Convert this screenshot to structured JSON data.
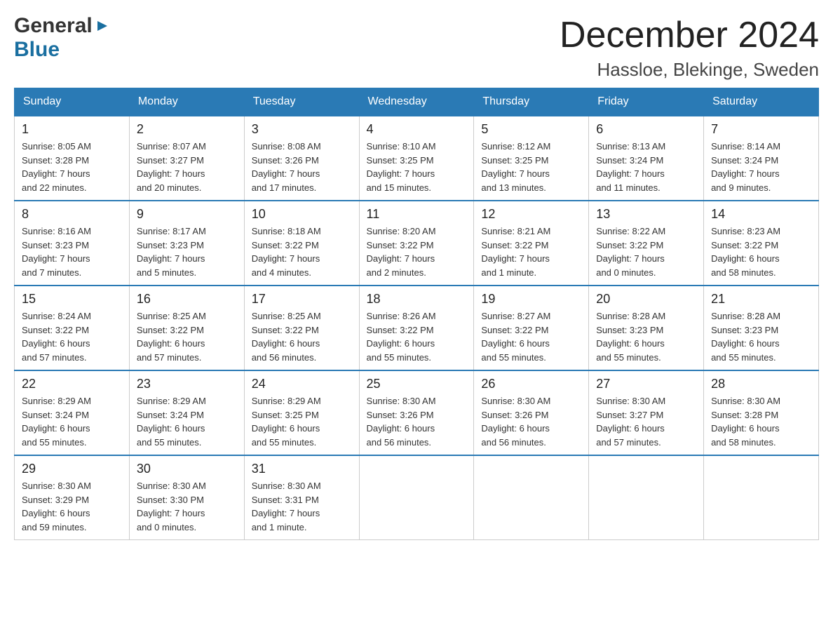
{
  "logo": {
    "general": "General",
    "blue": "Blue",
    "triangle": "▶"
  },
  "title": "December 2024",
  "location": "Hassloe, Blekinge, Sweden",
  "headers": [
    "Sunday",
    "Monday",
    "Tuesday",
    "Wednesday",
    "Thursday",
    "Friday",
    "Saturday"
  ],
  "weeks": [
    [
      {
        "day": "1",
        "sunrise": "Sunrise: 8:05 AM",
        "sunset": "Sunset: 3:28 PM",
        "daylight": "Daylight: 7 hours",
        "daylight2": "and 22 minutes."
      },
      {
        "day": "2",
        "sunrise": "Sunrise: 8:07 AM",
        "sunset": "Sunset: 3:27 PM",
        "daylight": "Daylight: 7 hours",
        "daylight2": "and 20 minutes."
      },
      {
        "day": "3",
        "sunrise": "Sunrise: 8:08 AM",
        "sunset": "Sunset: 3:26 PM",
        "daylight": "Daylight: 7 hours",
        "daylight2": "and 17 minutes."
      },
      {
        "day": "4",
        "sunrise": "Sunrise: 8:10 AM",
        "sunset": "Sunset: 3:25 PM",
        "daylight": "Daylight: 7 hours",
        "daylight2": "and 15 minutes."
      },
      {
        "day": "5",
        "sunrise": "Sunrise: 8:12 AM",
        "sunset": "Sunset: 3:25 PM",
        "daylight": "Daylight: 7 hours",
        "daylight2": "and 13 minutes."
      },
      {
        "day": "6",
        "sunrise": "Sunrise: 8:13 AM",
        "sunset": "Sunset: 3:24 PM",
        "daylight": "Daylight: 7 hours",
        "daylight2": "and 11 minutes."
      },
      {
        "day": "7",
        "sunrise": "Sunrise: 8:14 AM",
        "sunset": "Sunset: 3:24 PM",
        "daylight": "Daylight: 7 hours",
        "daylight2": "and 9 minutes."
      }
    ],
    [
      {
        "day": "8",
        "sunrise": "Sunrise: 8:16 AM",
        "sunset": "Sunset: 3:23 PM",
        "daylight": "Daylight: 7 hours",
        "daylight2": "and 7 minutes."
      },
      {
        "day": "9",
        "sunrise": "Sunrise: 8:17 AM",
        "sunset": "Sunset: 3:23 PM",
        "daylight": "Daylight: 7 hours",
        "daylight2": "and 5 minutes."
      },
      {
        "day": "10",
        "sunrise": "Sunrise: 8:18 AM",
        "sunset": "Sunset: 3:22 PM",
        "daylight": "Daylight: 7 hours",
        "daylight2": "and 4 minutes."
      },
      {
        "day": "11",
        "sunrise": "Sunrise: 8:20 AM",
        "sunset": "Sunset: 3:22 PM",
        "daylight": "Daylight: 7 hours",
        "daylight2": "and 2 minutes."
      },
      {
        "day": "12",
        "sunrise": "Sunrise: 8:21 AM",
        "sunset": "Sunset: 3:22 PM",
        "daylight": "Daylight: 7 hours",
        "daylight2": "and 1 minute."
      },
      {
        "day": "13",
        "sunrise": "Sunrise: 8:22 AM",
        "sunset": "Sunset: 3:22 PM",
        "daylight": "Daylight: 7 hours",
        "daylight2": "and 0 minutes."
      },
      {
        "day": "14",
        "sunrise": "Sunrise: 8:23 AM",
        "sunset": "Sunset: 3:22 PM",
        "daylight": "Daylight: 6 hours",
        "daylight2": "and 58 minutes."
      }
    ],
    [
      {
        "day": "15",
        "sunrise": "Sunrise: 8:24 AM",
        "sunset": "Sunset: 3:22 PM",
        "daylight": "Daylight: 6 hours",
        "daylight2": "and 57 minutes."
      },
      {
        "day": "16",
        "sunrise": "Sunrise: 8:25 AM",
        "sunset": "Sunset: 3:22 PM",
        "daylight": "Daylight: 6 hours",
        "daylight2": "and 57 minutes."
      },
      {
        "day": "17",
        "sunrise": "Sunrise: 8:25 AM",
        "sunset": "Sunset: 3:22 PM",
        "daylight": "Daylight: 6 hours",
        "daylight2": "and 56 minutes."
      },
      {
        "day": "18",
        "sunrise": "Sunrise: 8:26 AM",
        "sunset": "Sunset: 3:22 PM",
        "daylight": "Daylight: 6 hours",
        "daylight2": "and 55 minutes."
      },
      {
        "day": "19",
        "sunrise": "Sunrise: 8:27 AM",
        "sunset": "Sunset: 3:22 PM",
        "daylight": "Daylight: 6 hours",
        "daylight2": "and 55 minutes."
      },
      {
        "day": "20",
        "sunrise": "Sunrise: 8:28 AM",
        "sunset": "Sunset: 3:23 PM",
        "daylight": "Daylight: 6 hours",
        "daylight2": "and 55 minutes."
      },
      {
        "day": "21",
        "sunrise": "Sunrise: 8:28 AM",
        "sunset": "Sunset: 3:23 PM",
        "daylight": "Daylight: 6 hours",
        "daylight2": "and 55 minutes."
      }
    ],
    [
      {
        "day": "22",
        "sunrise": "Sunrise: 8:29 AM",
        "sunset": "Sunset: 3:24 PM",
        "daylight": "Daylight: 6 hours",
        "daylight2": "and 55 minutes."
      },
      {
        "day": "23",
        "sunrise": "Sunrise: 8:29 AM",
        "sunset": "Sunset: 3:24 PM",
        "daylight": "Daylight: 6 hours",
        "daylight2": "and 55 minutes."
      },
      {
        "day": "24",
        "sunrise": "Sunrise: 8:29 AM",
        "sunset": "Sunset: 3:25 PM",
        "daylight": "Daylight: 6 hours",
        "daylight2": "and 55 minutes."
      },
      {
        "day": "25",
        "sunrise": "Sunrise: 8:30 AM",
        "sunset": "Sunset: 3:26 PM",
        "daylight": "Daylight: 6 hours",
        "daylight2": "and 56 minutes."
      },
      {
        "day": "26",
        "sunrise": "Sunrise: 8:30 AM",
        "sunset": "Sunset: 3:26 PM",
        "daylight": "Daylight: 6 hours",
        "daylight2": "and 56 minutes."
      },
      {
        "day": "27",
        "sunrise": "Sunrise: 8:30 AM",
        "sunset": "Sunset: 3:27 PM",
        "daylight": "Daylight: 6 hours",
        "daylight2": "and 57 minutes."
      },
      {
        "day": "28",
        "sunrise": "Sunrise: 8:30 AM",
        "sunset": "Sunset: 3:28 PM",
        "daylight": "Daylight: 6 hours",
        "daylight2": "and 58 minutes."
      }
    ],
    [
      {
        "day": "29",
        "sunrise": "Sunrise: 8:30 AM",
        "sunset": "Sunset: 3:29 PM",
        "daylight": "Daylight: 6 hours",
        "daylight2": "and 59 minutes."
      },
      {
        "day": "30",
        "sunrise": "Sunrise: 8:30 AM",
        "sunset": "Sunset: 3:30 PM",
        "daylight": "Daylight: 7 hours",
        "daylight2": "and 0 minutes."
      },
      {
        "day": "31",
        "sunrise": "Sunrise: 8:30 AM",
        "sunset": "Sunset: 3:31 PM",
        "daylight": "Daylight: 7 hours",
        "daylight2": "and 1 minute."
      },
      null,
      null,
      null,
      null
    ]
  ]
}
